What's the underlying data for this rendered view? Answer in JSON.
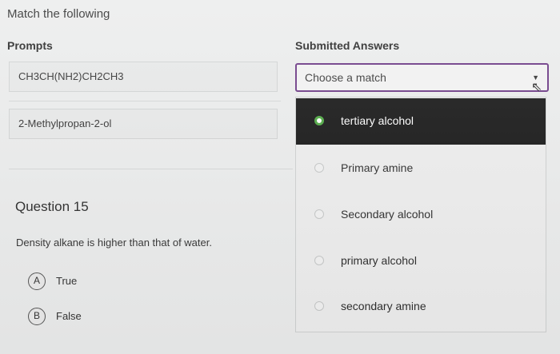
{
  "page": {
    "header": "Match the following"
  },
  "columns": {
    "prompts": "Prompts",
    "answers": "Submitted Answers"
  },
  "prompts": [
    {
      "text": "CH3CH(NH2)CH2CH3"
    },
    {
      "text": "2-Methylpropan-2-ol"
    }
  ],
  "select": {
    "value": "Choose a match",
    "caret": "▼",
    "cursor": "⇖"
  },
  "dropdown": {
    "options": [
      {
        "label": "tertiary alcohol",
        "selected": true
      },
      {
        "label": "Primary amine",
        "selected": false
      },
      {
        "label": "Secondary alcohol",
        "selected": false
      },
      {
        "label": "primary alcohol",
        "selected": false
      },
      {
        "label": "secondary amine",
        "selected": false
      }
    ]
  },
  "question": {
    "title": "Question 15",
    "text": "Density alkane is higher than that of water.",
    "choices": [
      {
        "letter": "A",
        "label": "True"
      },
      {
        "letter": "B",
        "label": "False"
      }
    ]
  },
  "colors": {
    "accent": "#6d3a86",
    "selected_radio": "#4ea842",
    "highlight_bg": "#161616"
  }
}
